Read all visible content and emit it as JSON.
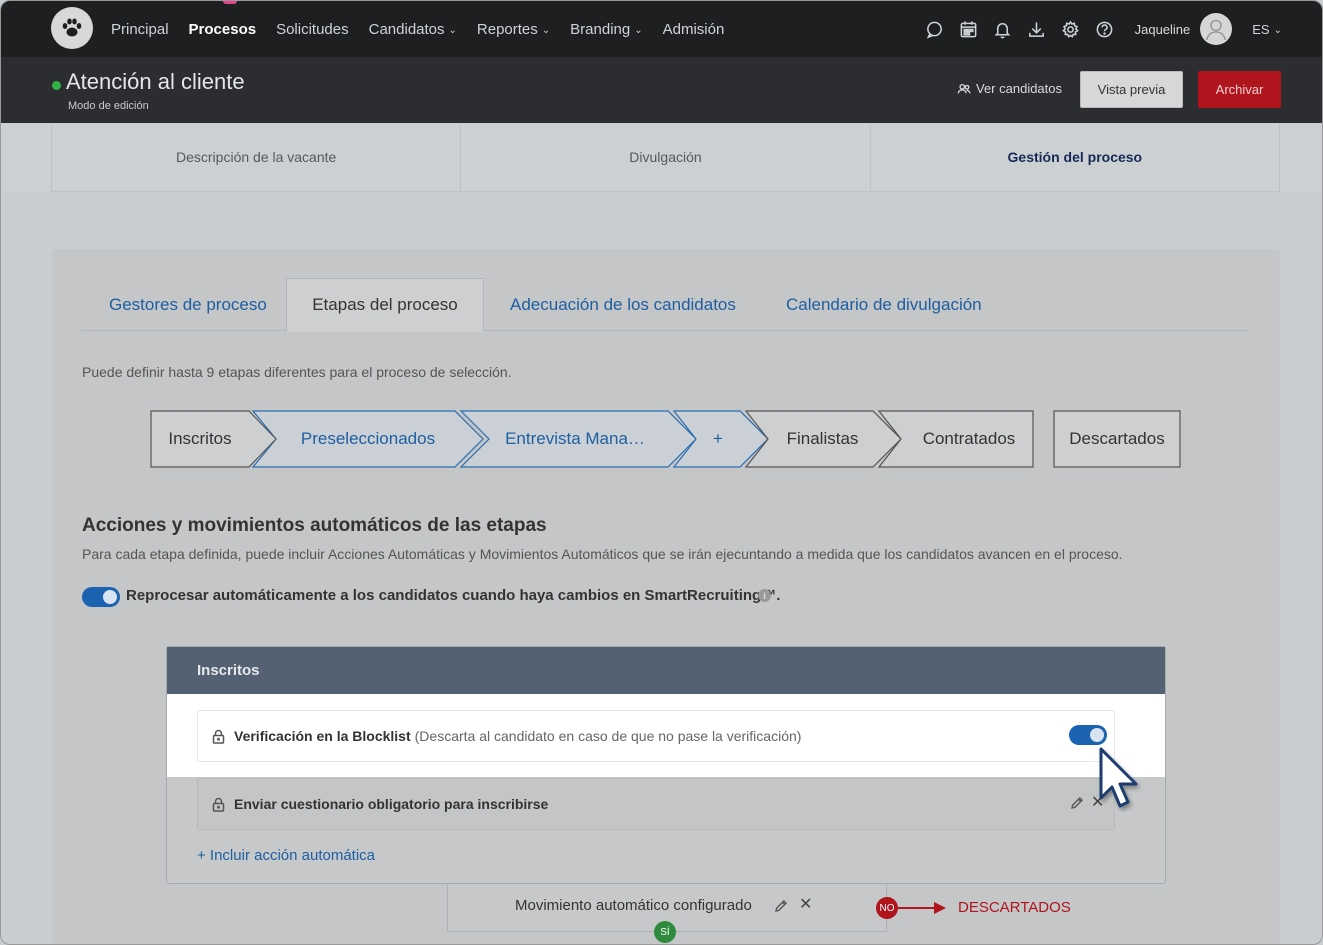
{
  "nav": {
    "items": [
      {
        "label": "Principal",
        "active": false,
        "dropdown": false
      },
      {
        "label": "Procesos",
        "active": true,
        "dropdown": false
      },
      {
        "label": "Solicitudes",
        "active": false,
        "dropdown": false
      },
      {
        "label": "Candidatos",
        "active": false,
        "dropdown": true
      },
      {
        "label": "Reportes",
        "active": false,
        "dropdown": true
      },
      {
        "label": "Branding",
        "active": false,
        "dropdown": true
      },
      {
        "label": "Admisión",
        "active": false,
        "dropdown": false
      }
    ],
    "icons": [
      "chat-icon",
      "calendar-icon",
      "bell-icon",
      "download-icon",
      "gear-icon",
      "help-icon"
    ],
    "user_name": "Jaqueline",
    "language": "ES"
  },
  "header": {
    "title": "Atención al cliente",
    "subtitle": "Modo de edición",
    "status_color": "#2fb345",
    "view_candidates": "Ver candidatos",
    "preview": "Vista previa",
    "archive": "Archivar"
  },
  "main_tabs": [
    {
      "label": "Descripción de la vacante",
      "active": false
    },
    {
      "label": "Divulgación",
      "active": false
    },
    {
      "label": "Gestión del proceso",
      "active": true
    }
  ],
  "sub_tabs": [
    {
      "label": "Gestores de proceso",
      "active": false
    },
    {
      "label": "Etapas del proceso",
      "active": true
    },
    {
      "label": "Adecuación de los candidatos",
      "active": false
    },
    {
      "label": "Calendario de divulgación",
      "active": false
    }
  ],
  "stages_hint": "Puede definir hasta 9 etapas diferentes para el proceso de selección.",
  "stages": [
    {
      "label": "Inscritos",
      "highlight": false
    },
    {
      "label": "Preseleccionados",
      "highlight": true
    },
    {
      "label": "Entrevista Mana…",
      "highlight": true
    },
    {
      "label": "+",
      "highlight": true
    },
    {
      "label": "Finalistas",
      "highlight": false
    },
    {
      "label": "Contratados",
      "highlight": false
    },
    {
      "label": "Descartados",
      "highlight": false
    }
  ],
  "actions_section": {
    "title": "Acciones y movimientos automáticos de las etapas",
    "description": "Para cada etapa definida, puede incluir Acciones Automáticas y Movimientos Automáticos que se irán ejecuntando a medida que los candidatos avancen en el proceso.",
    "reprocess_label": "Reprocesar automáticamente a los candidatos cuando haya cambios en SmartRecruiting™.",
    "reprocess_enabled": true,
    "info": "i"
  },
  "stage_panel": {
    "title": "Inscritos",
    "actions": [
      {
        "name": "Verificación en la Blocklist",
        "note": "(Descarta al candidato en caso de que no pase la verificación)",
        "enabled": true
      },
      {
        "name": "Enviar cuestionario obligatorio para inscribirse",
        "note": ""
      }
    ],
    "add_action": "+ Incluir acción automática"
  },
  "movement": {
    "label": "Movimiento automático configurado",
    "no_badge": "NO",
    "yes_badge": "SÍ",
    "target": "DESCARTADOS"
  },
  "colors": {
    "accent_blue": "#1e5fa1",
    "archive_red": "#b0141c",
    "panel_head": "#536173"
  }
}
